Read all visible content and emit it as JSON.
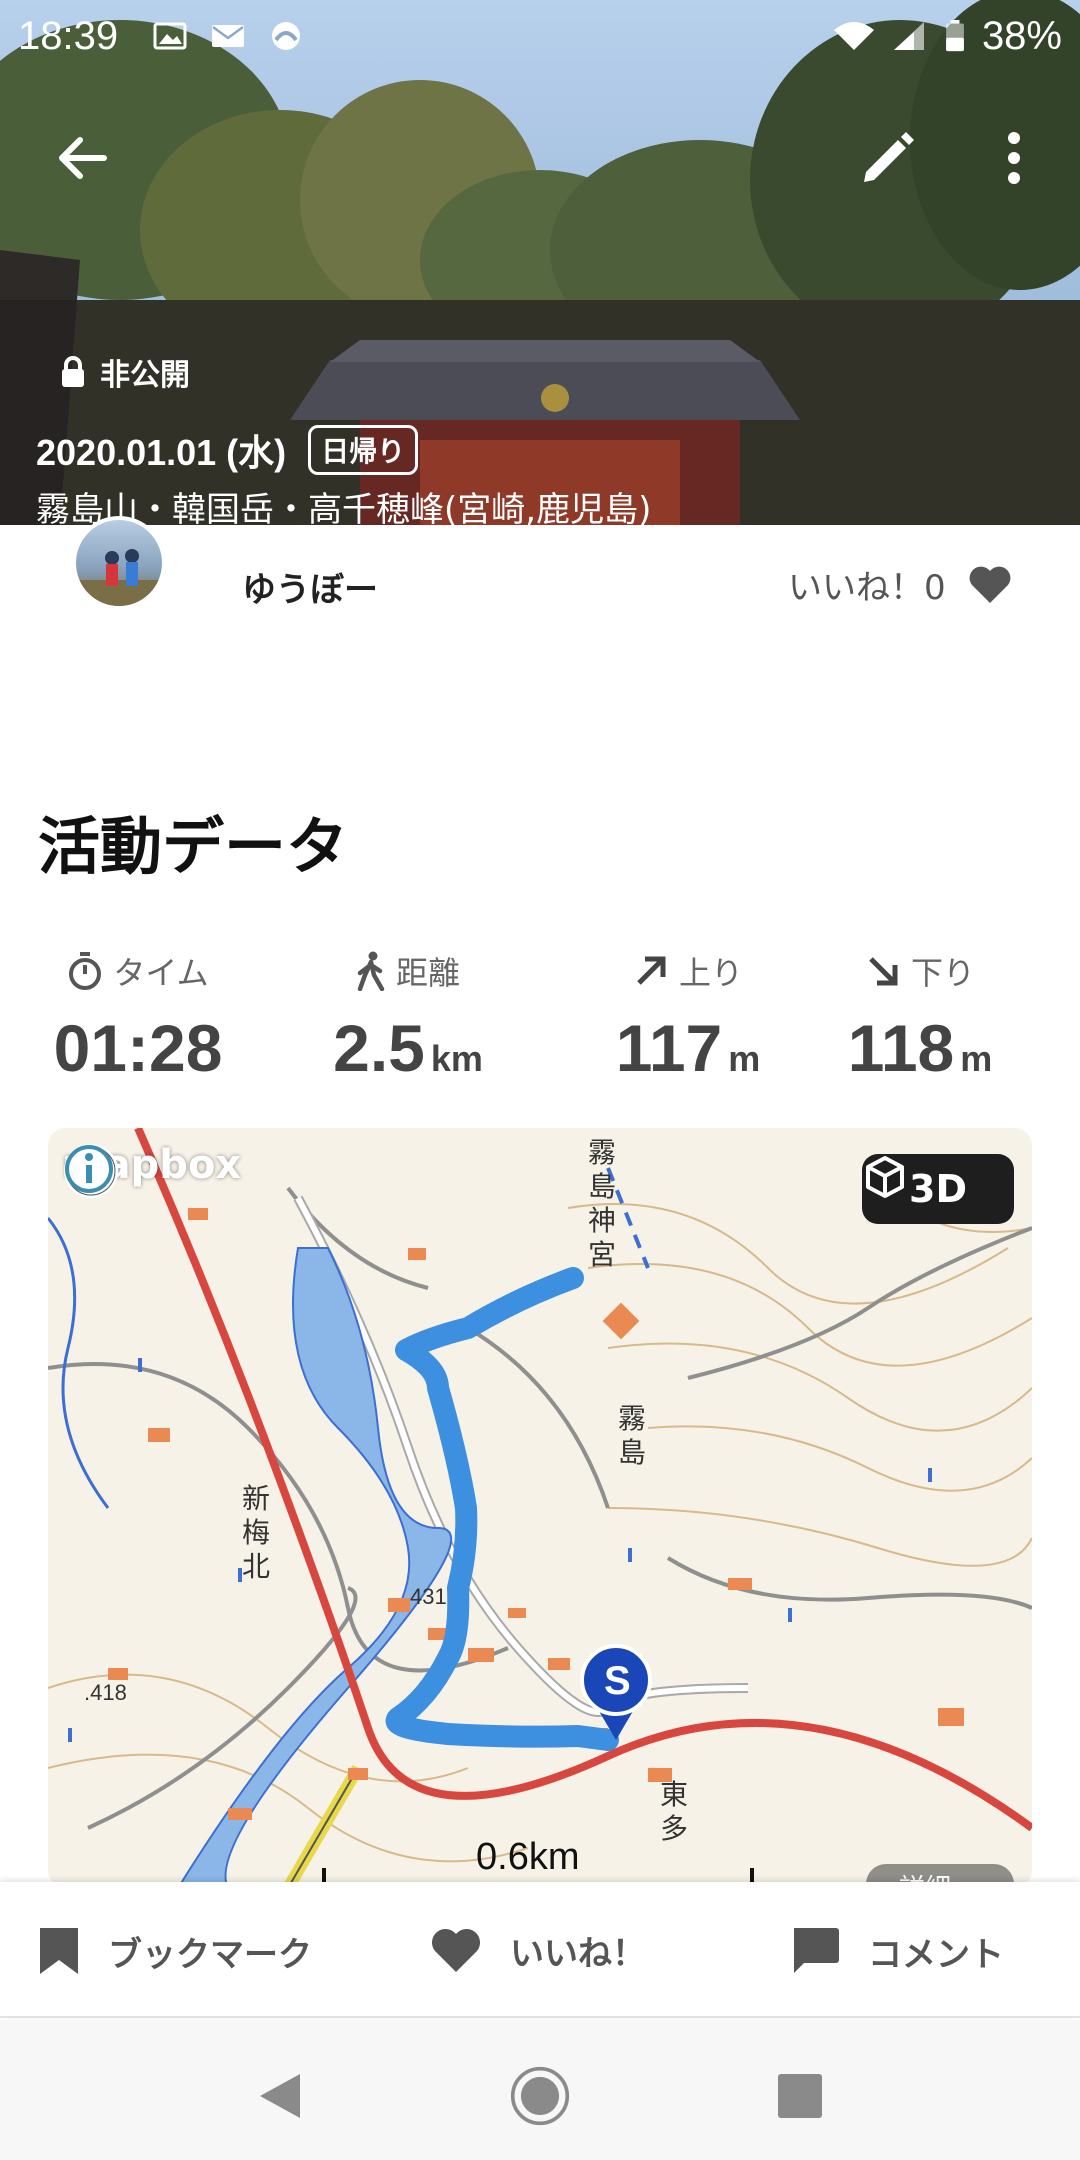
{
  "status_bar": {
    "time": "18:39",
    "battery": "38%",
    "icons_left": [
      "image-icon",
      "mail-icon",
      "app-icon"
    ],
    "icons_right": [
      "wifi-icon",
      "signal-icon",
      "battery-icon"
    ]
  },
  "header": {
    "back_icon": "arrow-left-icon",
    "edit_icon": "pencil-icon",
    "more_icon": "more-vert-icon"
  },
  "hike": {
    "visibility": "非公開",
    "date": "2020.01.01 (水)",
    "trip_type": "日帰り",
    "mountains": "霧島山・韓国岳・高千穂峰(宮崎,鹿児島)"
  },
  "user": {
    "name": "ゆうぼー",
    "likes_label": "いいね！0"
  },
  "activity": {
    "title": "活動データ",
    "stats": [
      {
        "label": "タイム",
        "value": "01:28",
        "unit": "",
        "icon": "stopwatch-icon"
      },
      {
        "label": "距離",
        "value": "2.5",
        "unit": "km",
        "icon": "walking-icon"
      },
      {
        "label": "上り",
        "value": "117",
        "unit": "m",
        "icon": "arrow-up-right-icon"
      },
      {
        "label": "下り",
        "value": "118",
        "unit": "m",
        "icon": "arrow-down-right-icon"
      }
    ]
  },
  "map": {
    "provider": "mapbox",
    "button_3d": "3D",
    "scale": "0.6km",
    "detail": "詳細 >",
    "labels": {
      "shrine": "霧島神宮",
      "kirishima": "霧島",
      "shin_umekita": "新梅北",
      "elev1": "431.4",
      "elev2": ".418",
      "higashi": "東多",
      "start_marker": "S"
    },
    "colors": {
      "route": "#3d8fe0",
      "road_red": "#d8473f",
      "river": "#8ab6e8"
    }
  },
  "actions": {
    "bookmark": "ブックマーク",
    "like": "いいね！",
    "comment": "コメント"
  }
}
